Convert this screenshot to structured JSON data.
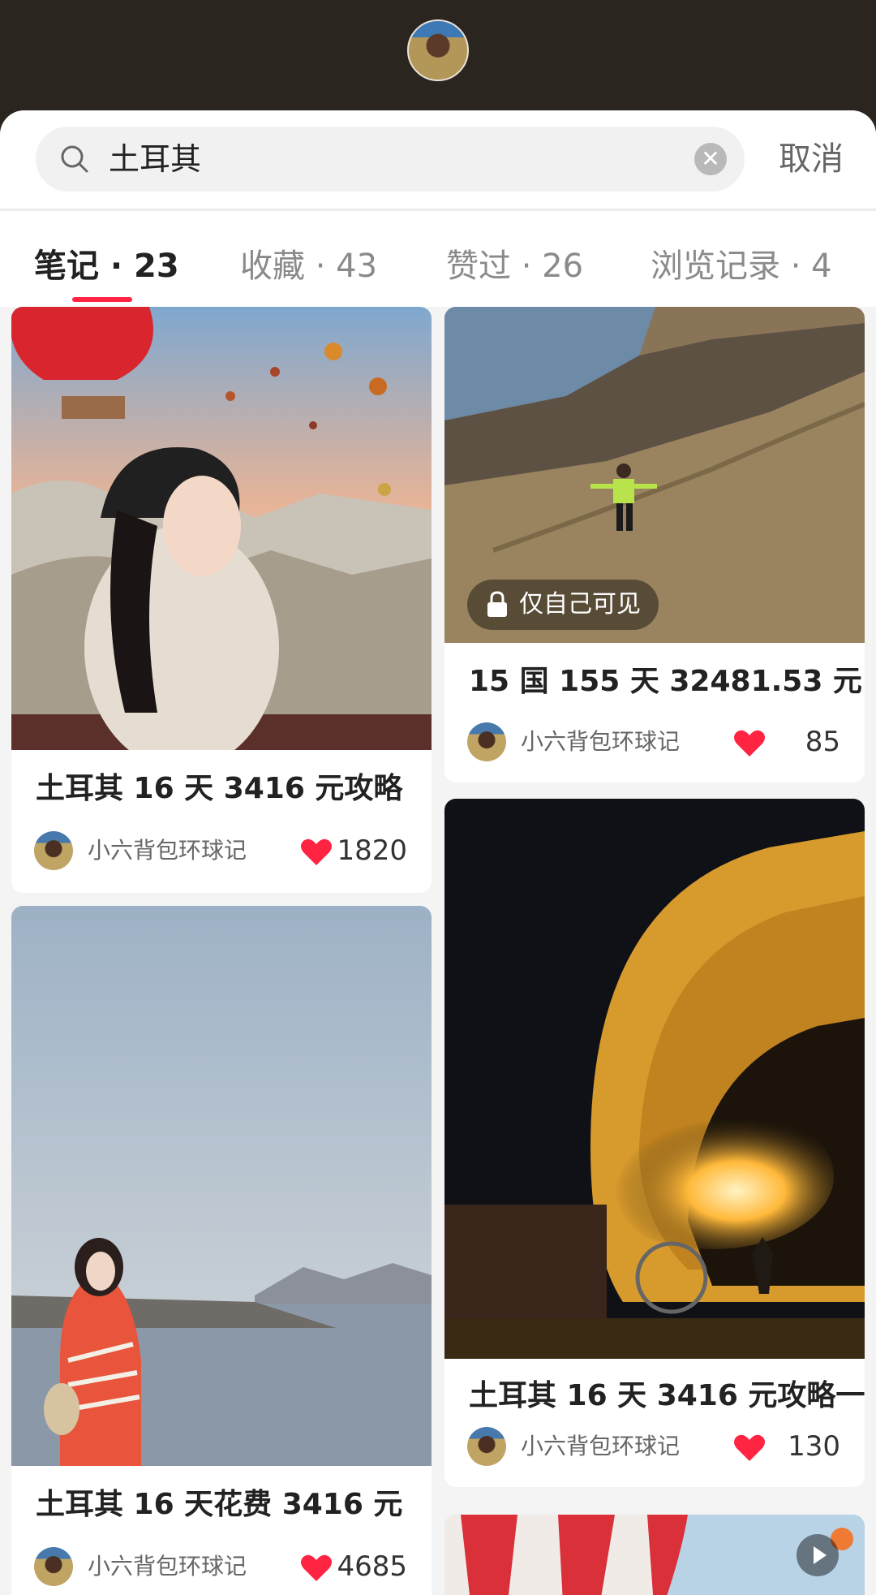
{
  "search": {
    "query": "土耳其",
    "cancel_label": "取消"
  },
  "tabs": [
    {
      "label": "笔记 · 23"
    },
    {
      "label": "收藏 · 43"
    },
    {
      "label": "赞过 · 26"
    },
    {
      "label": "浏览记录 · 4"
    }
  ],
  "active_tab": "笔记 · 23",
  "accent_color": "#ff2442",
  "cards": [
    {
      "title": "土耳其 16 天 3416 元攻略",
      "author": "小六背包环球记",
      "likes": "1820"
    },
    {
      "title": "15 国 155 天 32481.53 元",
      "author": "小六背包环球记",
      "likes": "85",
      "badge": "仅自己可见"
    },
    {
      "title": "土耳其 16 天花费 3416 元",
      "author": "小六背包环球记",
      "likes": "4685"
    },
    {
      "title": "土耳其 16 天 3416 元攻略一",
      "author": "小六背包环球记",
      "likes": "130"
    },
    {
      "media": "video"
    }
  ],
  "icons": [
    "avatar",
    "search-icon",
    "clear-icon",
    "heart-icon",
    "lock-icon",
    "play-icon"
  ]
}
